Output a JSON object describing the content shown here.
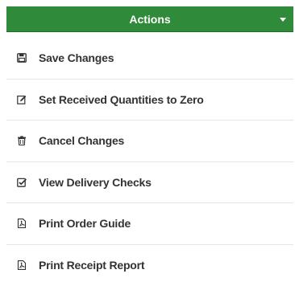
{
  "header": {
    "title": "Actions",
    "caret_icon": "caret-down-icon",
    "color": "#2f8a3a"
  },
  "items": [
    {
      "label": "Save Changes",
      "icon": "floppy-disk-icon"
    },
    {
      "label": "Set Received Quantities to Zero",
      "icon": "edit-icon"
    },
    {
      "label": "Cancel Changes",
      "icon": "trash-icon"
    },
    {
      "label": "View Delivery Checks",
      "icon": "checkbox-icon"
    },
    {
      "label": "Print Order Guide",
      "icon": "pdf-icon"
    },
    {
      "label": "Print Receipt Report",
      "icon": "pdf-icon"
    }
  ]
}
